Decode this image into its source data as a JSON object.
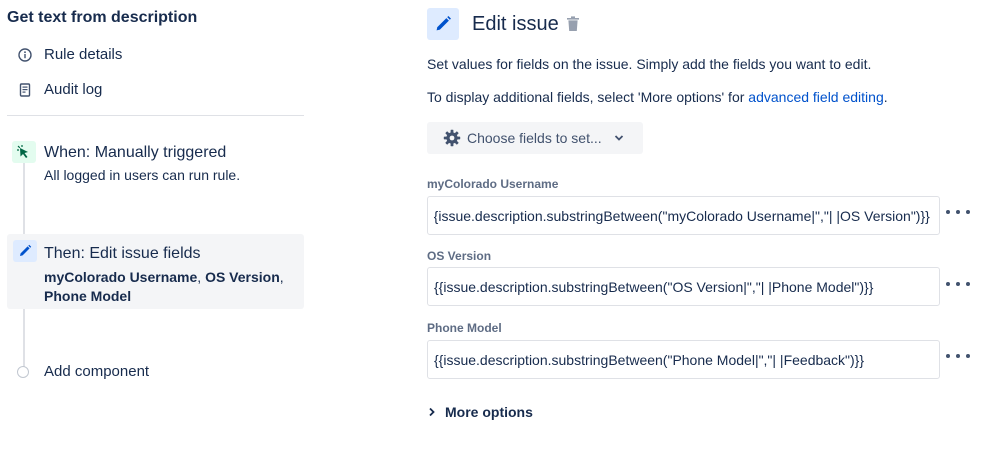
{
  "rule": {
    "title": "Get text from description",
    "nav": [
      {
        "label": "Rule details",
        "icon": "info-icon"
      },
      {
        "label": "Audit log",
        "icon": "audit-log-icon"
      }
    ]
  },
  "trigger": {
    "title": "When: Manually triggered",
    "subtitle": "All logged in users can run rule.",
    "icon": "cursor-click-icon",
    "badge_color": "#e3fcef"
  },
  "action": {
    "title": "Then: Edit issue fields",
    "fields": [
      "myColorado Username",
      "OS Version",
      "Phone Model"
    ],
    "separator": ", ",
    "icon": "pencil-icon",
    "badge_color": "#deebff"
  },
  "add_component": {
    "label": "Add component"
  },
  "editor": {
    "title": "Edit issue",
    "description_1": "Set values for fields on the issue. Simply add the fields you want to edit.",
    "description_2_prefix": "To display additional fields, select 'More options' for ",
    "description_2_link": "advanced field editing",
    "description_2_suffix": ".",
    "choose_fields_label": "Choose fields to set...",
    "fields": [
      {
        "label": "myColorado Username",
        "value": "{{issue.description.substringBetween(\"myColorado Username|\",\"| |OS Version\")}}"
      },
      {
        "label": "OS Version",
        "value": "{{issue.description.substringBetween(\"OS Version|\",\"| |Phone Model\")}}"
      },
      {
        "label": "Phone Model",
        "value": "{{issue.description.substringBetween(\"Phone Model|\",\"| |Feedback\")}}"
      }
    ],
    "more_options_label": "More options"
  },
  "colors": {
    "text": "#172b4d",
    "link": "#0052cc",
    "selected_bg": "#f4f5f7"
  }
}
